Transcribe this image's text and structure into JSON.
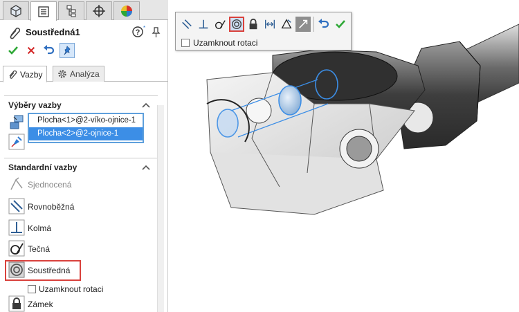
{
  "property_manager": {
    "title": "Soustředná1",
    "tabs": [
      {
        "name": "featuremanager",
        "icon": "featuremanager-icon"
      },
      {
        "name": "propertymanager",
        "icon": "propertymanager-icon"
      },
      {
        "name": "configurationmanager",
        "icon": "configuration-icon"
      },
      {
        "name": "dimxpert",
        "icon": "crosshair-icon"
      },
      {
        "name": "display-manager",
        "icon": "appearance-icon"
      }
    ],
    "sub_tabs": {
      "mates": "Vazby",
      "analysis": "Analýza"
    },
    "sections": {
      "selections_title": "Výběry vazby",
      "standard_title": "Standardní vazby"
    },
    "selections": [
      "Plocha<1>@2-víko-ojnice-1",
      "Plocha<2>@2-ojnice-1"
    ],
    "standard_mates": {
      "coincident": "Sjednocená",
      "parallel": "Rovnoběžná",
      "perpendicular": "Kolmá",
      "tangent": "Tečná",
      "concentric": "Soustředná",
      "lock_rotation": "Uzamknout rotaci",
      "lock": "Zámek"
    }
  },
  "mate_toolbar": {
    "lock_rotation": "Uzamknout rotaci",
    "buttons": [
      "parallel-icon",
      "perpendicular-icon",
      "tangent-icon",
      "concentric-icon",
      "lock-icon",
      "distance-icon",
      "angle-icon",
      "mate-alignment-icon",
      "undo-icon",
      "ok-icon"
    ]
  },
  "colors": {
    "accent_blue": "#3c8ee6",
    "highlight_red": "#d9413c",
    "ok_green": "#2ea836",
    "cancel_red": "#d42a2a"
  }
}
